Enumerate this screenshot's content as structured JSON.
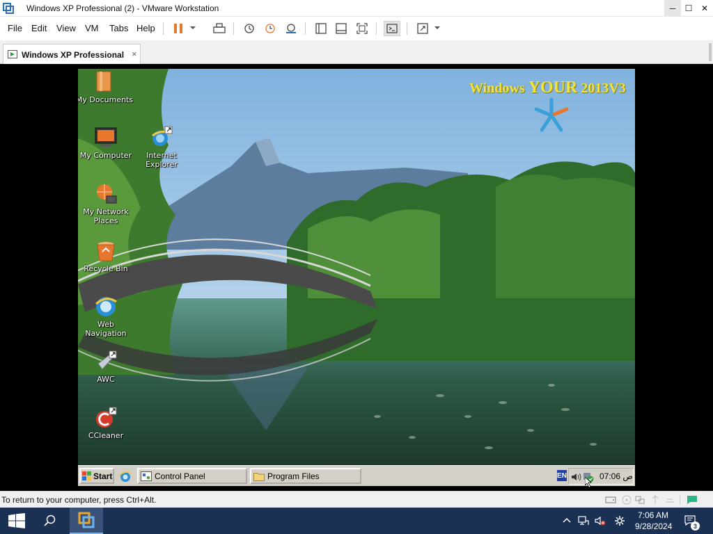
{
  "window": {
    "title": "Windows XP Professional (2) - VMware Workstation",
    "minimize": "─",
    "maximize": "☐",
    "close": "✕"
  },
  "menu": [
    "File",
    "Edit",
    "View",
    "VM",
    "Tabs",
    "Help"
  ],
  "tab": {
    "label": "Windows XP Professional (...",
    "close": "×"
  },
  "guest": {
    "brand_prefix": "Windows ",
    "brand_mid": "YOUR",
    "brand_suffix": " 2013V3",
    "desktop_icons": [
      {
        "label": "My Documents",
        "icon": "my-documents-icon"
      },
      {
        "label": "My Computer",
        "icon": "my-computer-icon"
      },
      {
        "label": "Internet Explorer",
        "icon": "internet-explorer-icon"
      },
      {
        "label": "My Network Places",
        "icon": "network-places-icon"
      },
      {
        "label": "Recycle Bin",
        "icon": "recycle-bin-icon"
      },
      {
        "label": "Web Navigation",
        "icon": "web-navigation-icon"
      },
      {
        "label": "AWC",
        "icon": "awc-icon"
      },
      {
        "label": "CCleaner",
        "icon": "ccleaner-icon"
      }
    ],
    "taskbar": {
      "start_label": "Start",
      "buttons": [
        "Control Panel",
        "Program Files"
      ],
      "lang": "EN",
      "clock": "07:06 ص"
    }
  },
  "status": {
    "text": "To return to your computer, press Ctrl+Alt."
  },
  "host_taskbar": {
    "time": "7:06 AM",
    "date": "9/28/2024",
    "notifications": "3"
  },
  "colors": {
    "host_taskbar": "#1b3153",
    "xp_taskbar": "#d4d0c8",
    "pause_orange": "#e8772e",
    "brand_yellow": "#f2e23a"
  }
}
